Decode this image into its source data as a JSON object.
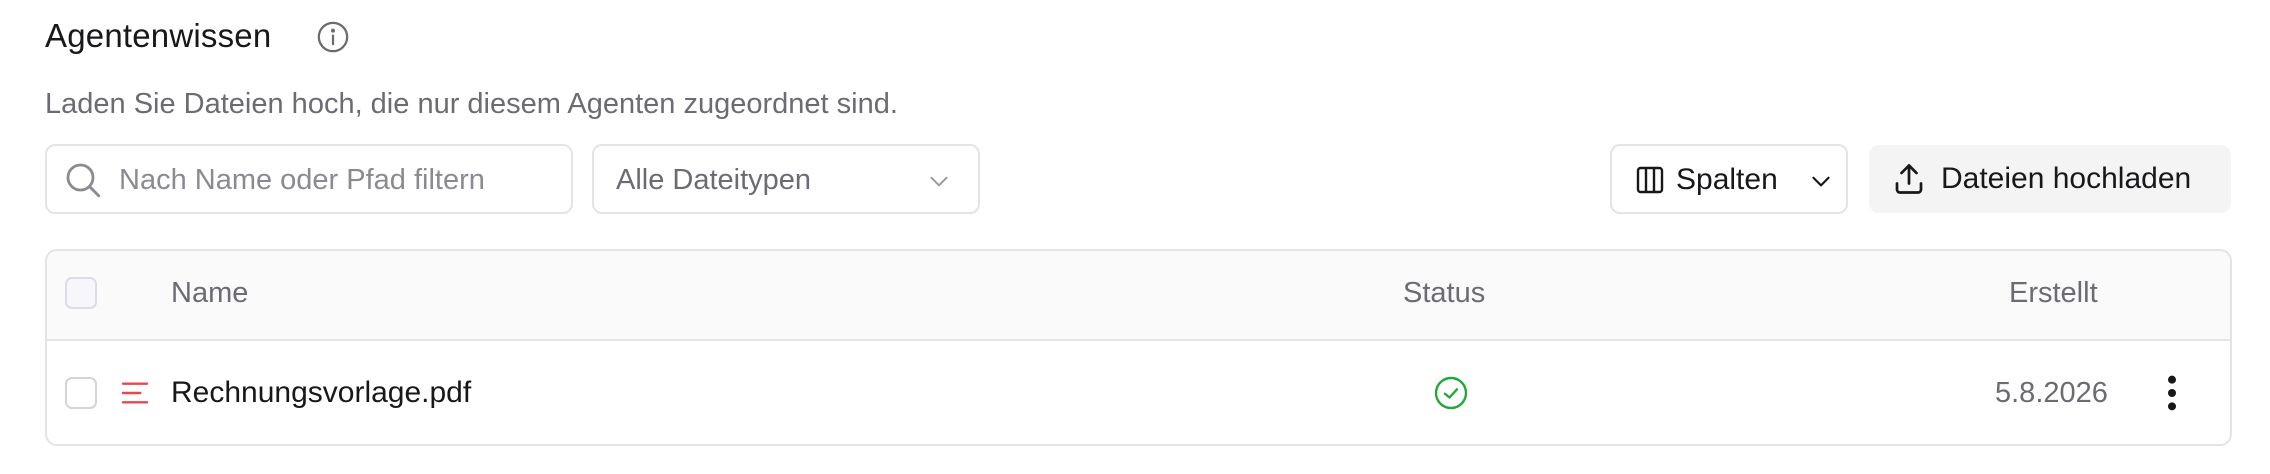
{
  "section": {
    "title": "Agentenwissen",
    "subtitle": "Laden Sie Dateien hoch, die nur diesem Agenten zugeordnet sind."
  },
  "toolbar": {
    "search_placeholder": "Nach Name oder Pfad filtern",
    "search_value": "",
    "type_filter_selected": "Alle Dateitypen",
    "columns_label": "Spalten",
    "upload_label": "Dateien hochladen"
  },
  "table": {
    "columns": [
      "Name",
      "Status",
      "Erstellt"
    ],
    "rows": [
      {
        "name": "Rechnungsvorlage.pdf",
        "status": "success",
        "created": "5.8.2026"
      }
    ]
  },
  "icons": {
    "info": "info-icon",
    "search": "search-icon",
    "chevron": "chevron-down-icon",
    "columns": "columns-icon",
    "upload": "upload-icon",
    "file": "file-text-icon",
    "status": "check-circle-icon",
    "menu": "more-vertical-icon"
  },
  "colors": {
    "status_success": "#22a83a",
    "file_icon": "#e5484d",
    "border": "#e4e4e7",
    "muted_text": "#6b6b73"
  }
}
